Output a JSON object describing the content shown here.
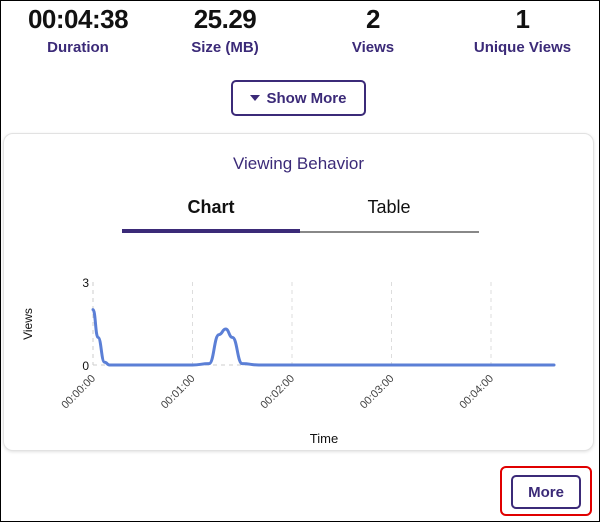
{
  "stats": [
    {
      "value": "00:04:38",
      "label": "Duration"
    },
    {
      "value": "25.29",
      "label": "Size (MB)"
    },
    {
      "value": "2",
      "label": "Views"
    },
    {
      "value": "1",
      "label": "Unique Views"
    }
  ],
  "show_more_label": "Show More",
  "card": {
    "title": "Viewing Behavior",
    "tabs": [
      {
        "label": "Chart",
        "active": true
      },
      {
        "label": "Table",
        "active": false
      }
    ]
  },
  "more_label": "More",
  "colors": {
    "accent": "#3b2a78",
    "line": "#5b7fd6",
    "highlight": "#e00000"
  },
  "chart_data": {
    "type": "line",
    "title": "",
    "xlabel": "Time",
    "ylabel": "Views",
    "ylim": [
      0,
      3
    ],
    "yticks": [
      "0",
      "3"
    ],
    "xlim_seconds": [
      0,
      278
    ],
    "xticks": [
      "00:00:00",
      "00:01:00",
      "00:02:00",
      "00:03:00",
      "00:04:00"
    ],
    "grid": "vertical-dashed",
    "series": [
      {
        "name": "Views",
        "x_seconds": [
          0,
          3,
          7,
          10,
          60,
          70,
          76,
          80,
          84,
          90,
          100,
          278
        ],
        "values": [
          2,
          1,
          0.1,
          0,
          0,
          0.05,
          1.1,
          1.3,
          1.0,
          0.05,
          0,
          0
        ]
      }
    ]
  }
}
